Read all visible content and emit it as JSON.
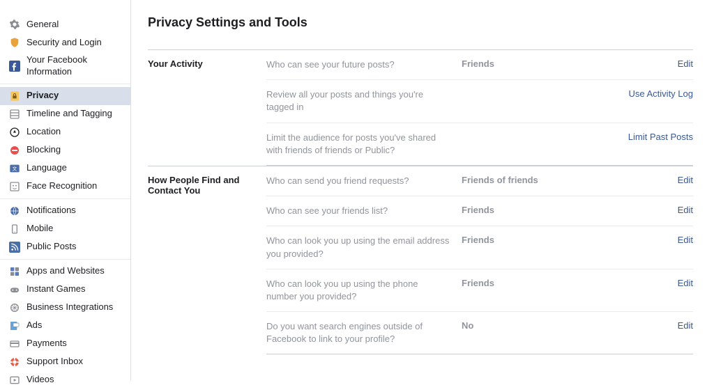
{
  "sidebar": {
    "groups": [
      {
        "items": [
          {
            "id": "general",
            "label": "General",
            "icon": "gear"
          },
          {
            "id": "security",
            "label": "Security and Login",
            "icon": "shield"
          },
          {
            "id": "yourinfo",
            "label": "Your Facebook Information",
            "icon": "fb"
          }
        ]
      },
      {
        "items": [
          {
            "id": "privacy",
            "label": "Privacy",
            "icon": "lock",
            "active": true
          },
          {
            "id": "timeline",
            "label": "Timeline and Tagging",
            "icon": "timeline"
          },
          {
            "id": "location",
            "label": "Location",
            "icon": "location"
          },
          {
            "id": "blocking",
            "label": "Blocking",
            "icon": "block"
          },
          {
            "id": "language",
            "label": "Language",
            "icon": "language"
          },
          {
            "id": "facerec",
            "label": "Face Recognition",
            "icon": "face"
          }
        ]
      },
      {
        "items": [
          {
            "id": "notifications",
            "label": "Notifications",
            "icon": "globe"
          },
          {
            "id": "mobile",
            "label": "Mobile",
            "icon": "mobile"
          },
          {
            "id": "publicposts",
            "label": "Public Posts",
            "icon": "rss"
          }
        ]
      },
      {
        "items": [
          {
            "id": "apps",
            "label": "Apps and Websites",
            "icon": "apps"
          },
          {
            "id": "instantgames",
            "label": "Instant Games",
            "icon": "games"
          },
          {
            "id": "bizint",
            "label": "Business Integrations",
            "icon": "biz"
          },
          {
            "id": "ads",
            "label": "Ads",
            "icon": "ads"
          },
          {
            "id": "payments",
            "label": "Payments",
            "icon": "payments"
          },
          {
            "id": "support",
            "label": "Support Inbox",
            "icon": "support"
          },
          {
            "id": "videos",
            "label": "Videos",
            "icon": "videos"
          }
        ]
      }
    ]
  },
  "main": {
    "title": "Privacy Settings and Tools",
    "sections": [
      {
        "title": "Your Activity",
        "rows": [
          {
            "desc": "Who can see your future posts?",
            "value": "Friends",
            "action": "Edit"
          },
          {
            "desc": "Review all your posts and things you're tagged in",
            "value": "",
            "action": "Use Activity Log"
          },
          {
            "desc": "Limit the audience for posts you've shared with friends of friends or Public?",
            "value": "",
            "action": "Limit Past Posts"
          }
        ]
      },
      {
        "title": "How People Find and Contact You",
        "rows": [
          {
            "desc": "Who can send you friend requests?",
            "value": "Friends of friends",
            "action": "Edit"
          },
          {
            "desc": "Who can see your friends list?",
            "value": "Friends",
            "action": "Edit"
          },
          {
            "desc": "Who can look you up using the email address you provided?",
            "value": "Friends",
            "action": "Edit"
          },
          {
            "desc": "Who can look you up using the phone number you provided?",
            "value": "Friends",
            "action": "Edit"
          },
          {
            "desc": "Do you want search engines outside of Facebook to link to your profile?",
            "value": "No",
            "action": "Edit"
          }
        ]
      }
    ]
  }
}
